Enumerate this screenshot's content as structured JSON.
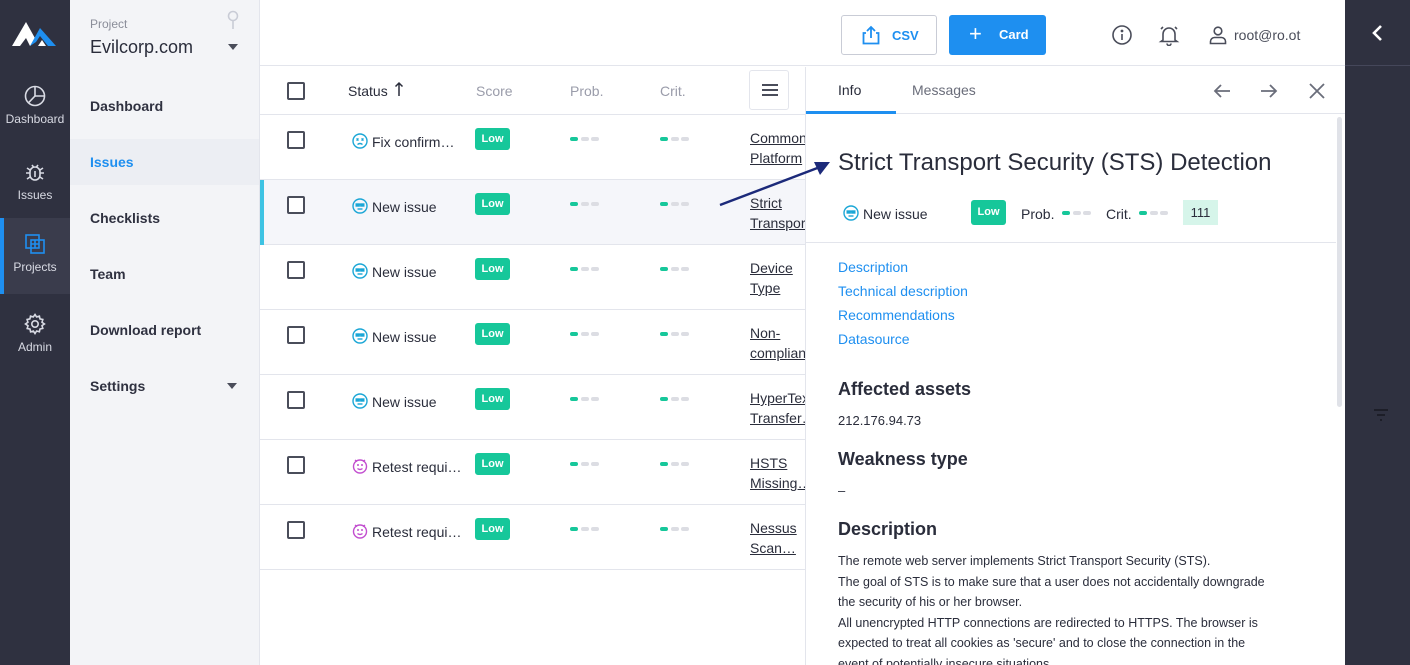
{
  "rail": {
    "items": [
      {
        "label": "Dashboard",
        "icon": "dashboard-icon"
      },
      {
        "label": "Issues",
        "icon": "bug-icon"
      },
      {
        "label": "Projects",
        "icon": "projects-icon"
      },
      {
        "label": "Admin",
        "icon": "gear-icon"
      }
    ],
    "active": "Projects"
  },
  "nav": {
    "project_caption": "Project",
    "project_name": "Evilcorp.com",
    "items": [
      {
        "label": "Dashboard"
      },
      {
        "label": "Issues"
      },
      {
        "label": "Checklists"
      },
      {
        "label": "Team"
      },
      {
        "label": "Download report"
      },
      {
        "label": "Settings"
      }
    ],
    "active": "Issues"
  },
  "toolbar": {
    "csv_label": "CSV",
    "card_label": "Card",
    "user": "root@ro.ot"
  },
  "list": {
    "headers": {
      "status": "Status",
      "score": "Score",
      "prob": "Prob.",
      "crit": "Crit."
    },
    "rows": [
      {
        "status": "Fix confirm…",
        "status_icon": "fix-confirmed-icon",
        "score": "Low",
        "name": "Common Platform",
        "name1": "Common",
        "name2": "Platform"
      },
      {
        "status": "New issue",
        "status_icon": "new-issue-icon",
        "score": "Low",
        "name1": "Strict",
        "name2": "Transport"
      },
      {
        "status": "New issue",
        "status_icon": "new-issue-icon",
        "score": "Low",
        "name1": "Device",
        "name2": "Type"
      },
      {
        "status": "New issue",
        "status_icon": "new-issue-icon",
        "score": "Low",
        "name1": "Non-",
        "name2": "compliant"
      },
      {
        "status": "New issue",
        "status_icon": "new-issue-icon",
        "score": "Low",
        "name1": "HyperText",
        "name2": "Transfer…"
      },
      {
        "status": "Retest requi…",
        "status_icon": "retest-icon",
        "score": "Low",
        "name1": "HSTS",
        "name2": "Missing…"
      },
      {
        "status": "Retest requi…",
        "status_icon": "retest-icon",
        "score": "Low",
        "name1": "Nessus",
        "name2": "Scan…"
      }
    ]
  },
  "detail": {
    "tabs": [
      "Info",
      "Messages"
    ],
    "title": "Strict Transport Security (STS) Detection",
    "status": "New issue",
    "score": "Low",
    "prob_label": "Prob.",
    "crit_label": "Crit.",
    "count": "111",
    "links": [
      "Description",
      "Technical description",
      "Recommendations",
      "Datasource"
    ],
    "affected_assets_title": "Affected assets",
    "affected_assets_value": "212.176.94.73",
    "weakness_title": "Weakness type",
    "weakness_value": "–",
    "description_title": "Description",
    "description_lines": [
      "The remote web server implements Strict Transport Security (STS).",
      "The goal of STS is to make sure that a user does not accidentally downgrade",
      "the security of his or her browser.",
      "All unencrypted HTTP connections are redirected to HTTPS. The browser is",
      "expected to treat all cookies as 'secure' and to close the connection in the",
      "event of potentially insecure situations."
    ]
  },
  "colors": {
    "accent": "#1e8ff0",
    "rail_bg": "#2f3140",
    "badge_low": "#16c79a",
    "active_row_marker": "#3ec3e3"
  }
}
